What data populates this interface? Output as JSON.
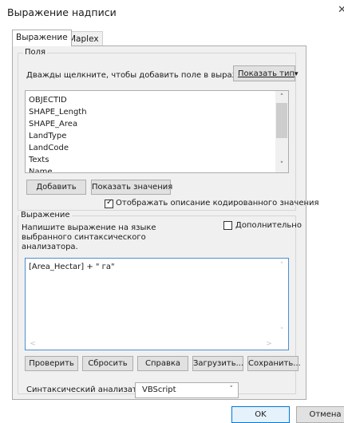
{
  "window": {
    "title": "Выражение надписи",
    "close_glyph": "✕"
  },
  "tabs": [
    {
      "label": "Выражение",
      "active": true
    },
    {
      "label": "Maplex",
      "active": false
    }
  ],
  "fields_group": {
    "title": "Поля",
    "hint": "Дважды щелкните, чтобы добавить поле в выражение",
    "show_type_button": "Показать тип",
    "dropdown_arrow": "▾",
    "items": [
      "OBJECTID",
      "SHAPE_Length",
      "SHAPE_Area",
      "LandType",
      "LandCode",
      "Texts",
      "Name"
    ],
    "add_button": "Добавить",
    "show_values_button": "Показать значения",
    "coded_checkbox_label": "Отображать описание кодированного значения",
    "coded_checkbox_checked": true,
    "scroll_up": "˄",
    "scroll_down": "˅"
  },
  "expression_group": {
    "title": "Выражение",
    "instruction": "Напишите выражение на языке выбранного синтаксического анализатора.",
    "advanced_label": "Дополнительно",
    "advanced_checked": false,
    "expression": "[Area_Hectar] + \" га\"",
    "verify_button": "Проверить",
    "reset_button": "Сбросить",
    "help_button": "Справка",
    "load_button": "Загрузить...",
    "save_button": "Сохранить...",
    "parser_label": "Синтаксический анализатор:",
    "parser_value": "VBScript",
    "scroll_up": "˄",
    "scroll_down": "˅",
    "scroll_left": "<",
    "scroll_right": ">",
    "chevron": "˅"
  },
  "footer": {
    "ok": "OK",
    "cancel": "Отмена"
  }
}
